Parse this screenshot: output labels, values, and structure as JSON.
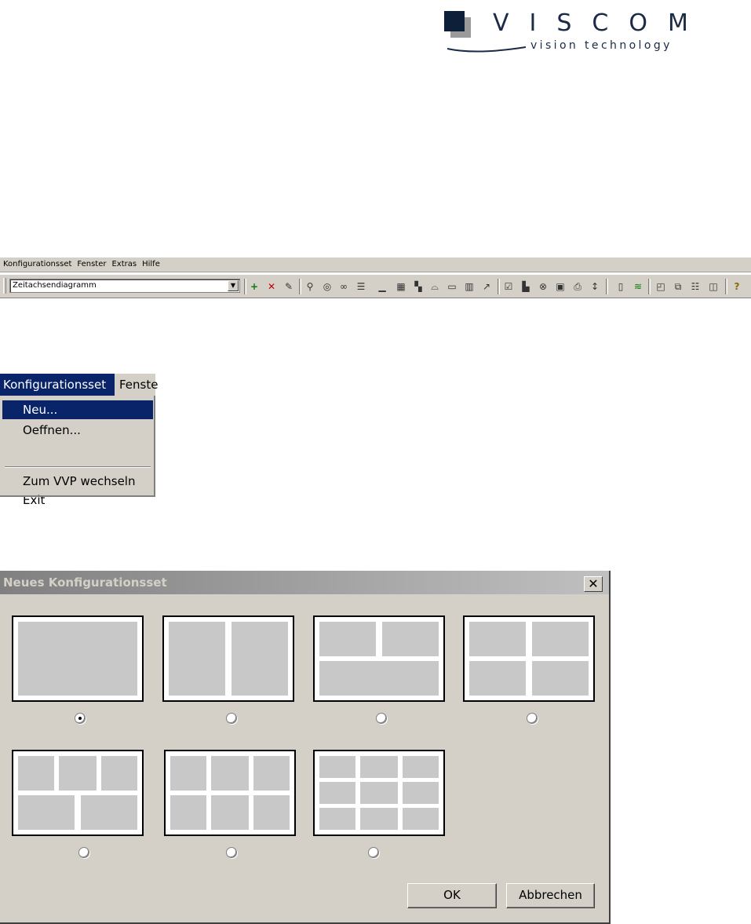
{
  "logo": {
    "brand": "VISCOM",
    "tagline": "vision technology"
  },
  "menubar": {
    "items": [
      "Konfigurationsset",
      "Fenster",
      "Extras",
      "Hilfe"
    ]
  },
  "toolbar": {
    "combo_value": "Zeitachsendiagramm",
    "icons": [
      "add-icon",
      "delete-icon",
      "edit-icon",
      "find-icon",
      "record-icon",
      "glasses-icon",
      "list-icon",
      "marker-icon",
      "pattern-icon",
      "step-icon",
      "curve-icon",
      "box-icon",
      "columns-icon",
      "pin-icon",
      "properties-icon",
      "folder-icon",
      "stop-icon",
      "save-icon",
      "print-icon",
      "sort-icon",
      "page-icon",
      "layers-icon",
      "new-window-icon",
      "cascade-icon",
      "tile-horizontal-icon",
      "tile-vertical-icon",
      "help-icon"
    ]
  },
  "menu_shot": {
    "active_menu": "Konfigurationsset",
    "next_menu": "Fenste",
    "items": [
      "Neu...",
      "Oeffnen...",
      "Zum VVP wechseln",
      "Exit"
    ]
  },
  "dialog": {
    "title": "Neues Konfigurationsset",
    "close_glyph": "✕",
    "selected_layout": 1,
    "ok_label": "OK",
    "cancel_label": "Abbrechen"
  },
  "colors": {
    "highlight": "#0a246a",
    "face": "#d4d0c8",
    "logo": "#0e1f3a"
  }
}
